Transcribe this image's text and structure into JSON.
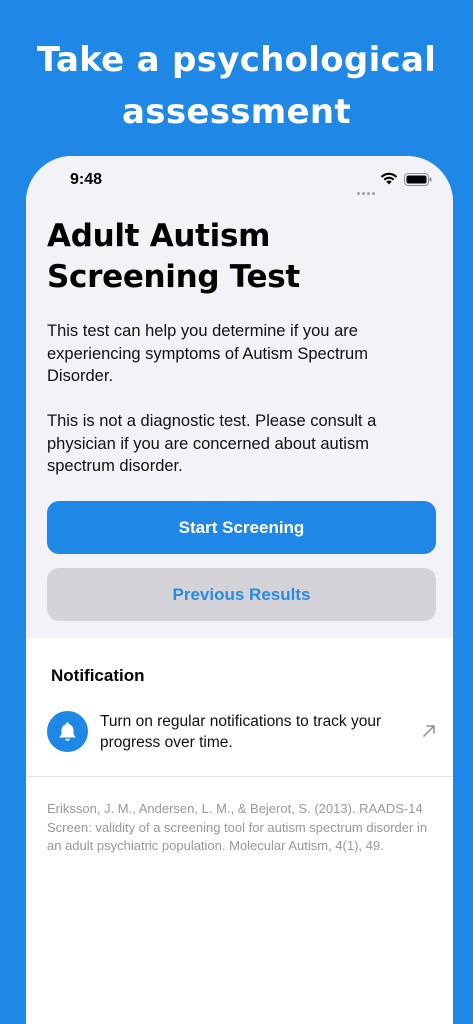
{
  "promo": {
    "line1": "Take a psychological",
    "line2": "assessment"
  },
  "status_bar": {
    "time": "9:48"
  },
  "screen": {
    "title": "Adult Autism Screening Test",
    "description_1": "This test can help you determine if you are experiencing symptoms of Autism Spectrum Disorder.",
    "description_2": "This is not a diagnostic test. Please consult a physician if you are concerned about autism spectrum disorder.",
    "start_button": "Start Screening",
    "previous_button": "Previous Results"
  },
  "notification": {
    "section_title": "Notification",
    "text": "Turn on regular notifications to track your progress over time.",
    "icon": "bell-icon"
  },
  "citation": "Eriksson, J. M., Andersen, L. M., & Bejerot, S. (2013). RAADS-14 Screen: validity of a screening tool for autism spectrum disorder in an adult psychiatric population. Molecular Autism, 4(1), 49.",
  "colors": {
    "accent": "#1f87e6",
    "secondary_button": "#d3d3d8",
    "background_grouped": "#f2f2f7"
  }
}
